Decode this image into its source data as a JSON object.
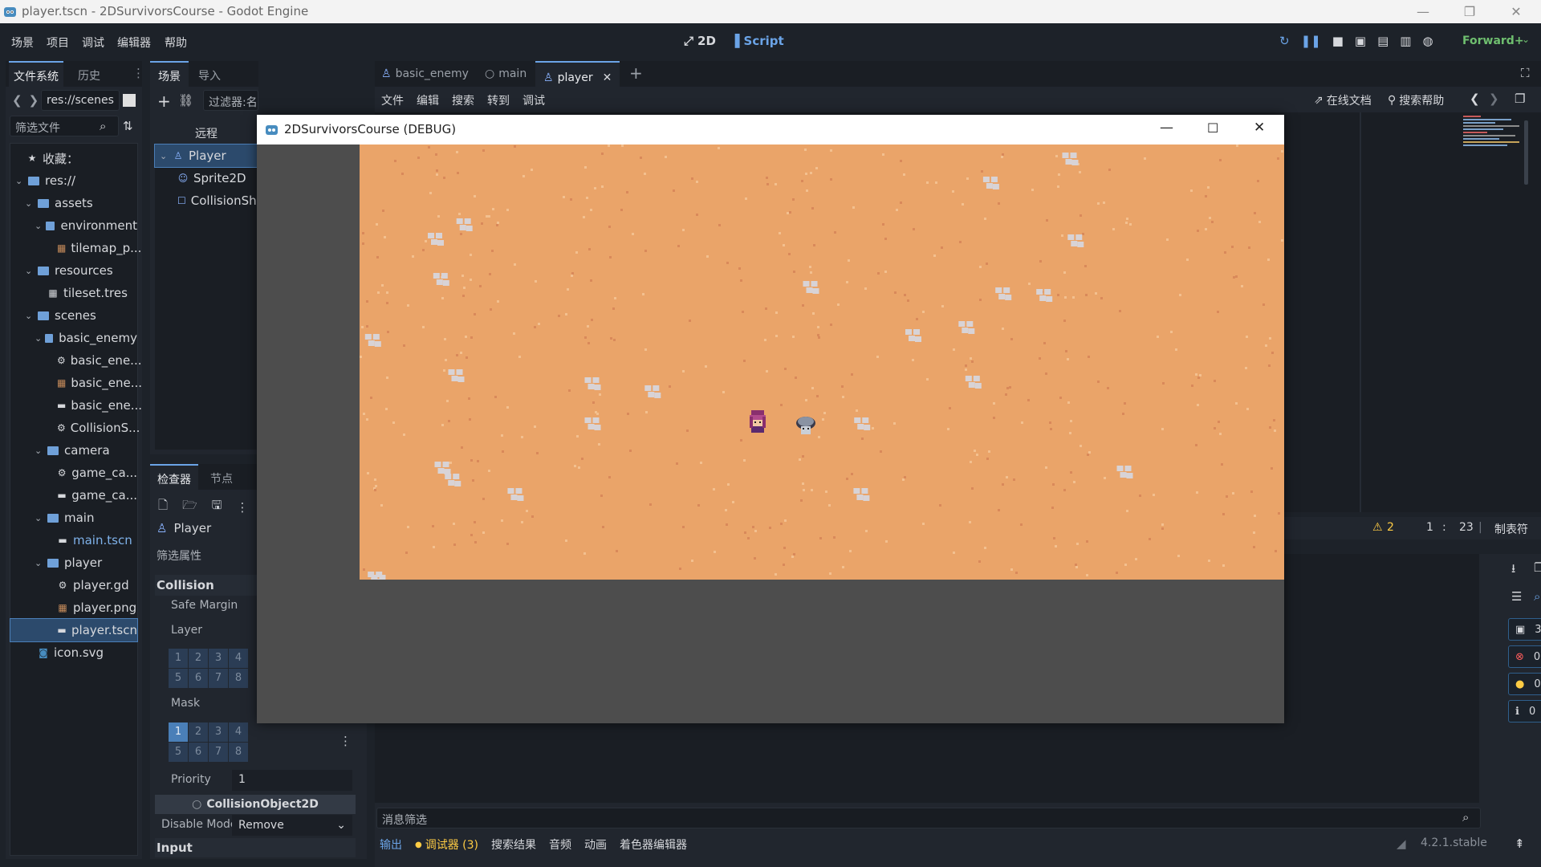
{
  "window": {
    "title": "player.tscn - 2DSurvivorsCourse - Godot Engine",
    "controls": [
      "—",
      "❐",
      "✕"
    ]
  },
  "menubar": {
    "items": [
      "场景",
      "项目",
      "调试",
      "编辑器",
      "帮助"
    ],
    "workspace_2d": "2D",
    "workspace_script": "Script",
    "renderer": "Forward+"
  },
  "filesystem": {
    "tab_files": "文件系统",
    "tab_history": "历史",
    "path": "res://scenes",
    "filter_placeholder": "筛选文件",
    "tree": [
      {
        "label": "收藏：",
        "depth": 0,
        "kind": "star"
      },
      {
        "label": "res://",
        "depth": 0,
        "kind": "folder"
      },
      {
        "label": "assets",
        "depth": 1,
        "kind": "folder"
      },
      {
        "label": "environment",
        "depth": 2,
        "kind": "folder"
      },
      {
        "label": "tilemap_p...",
        "depth": 3,
        "kind": "image"
      },
      {
        "label": "resources",
        "depth": 1,
        "kind": "folder"
      },
      {
        "label": "tileset.tres",
        "depth": 2,
        "kind": "tileset"
      },
      {
        "label": "scenes",
        "depth": 1,
        "kind": "folder"
      },
      {
        "label": "basic_enemy",
        "depth": 2,
        "kind": "folder"
      },
      {
        "label": "basic_ene...",
        "depth": 3,
        "kind": "gear"
      },
      {
        "label": "basic_ene...",
        "depth": 3,
        "kind": "image"
      },
      {
        "label": "basic_ene...",
        "depth": 3,
        "kind": "scene"
      },
      {
        "label": "CollisionS...",
        "depth": 3,
        "kind": "gear"
      },
      {
        "label": "camera",
        "depth": 2,
        "kind": "folder"
      },
      {
        "label": "game_ca...",
        "depth": 3,
        "kind": "gear"
      },
      {
        "label": "game_ca...",
        "depth": 3,
        "kind": "scene"
      },
      {
        "label": "main",
        "depth": 2,
        "kind": "folder"
      },
      {
        "label": "main.tscn",
        "depth": 3,
        "kind": "scene"
      },
      {
        "label": "player",
        "depth": 2,
        "kind": "folder"
      },
      {
        "label": "player.gd",
        "depth": 3,
        "kind": "gear"
      },
      {
        "label": "player.png",
        "depth": 3,
        "kind": "image"
      },
      {
        "label": "player.tscn",
        "depth": 3,
        "kind": "scene"
      },
      {
        "label": "icon.svg",
        "depth": 1,
        "kind": "svg"
      }
    ]
  },
  "scene_dock": {
    "tab_scene": "场景",
    "tab_import": "导入",
    "filter_placeholder": "过滤器:名称、t:",
    "remote": "远程",
    "nodes": [
      "Player",
      "Sprite2D",
      "CollisionSha"
    ]
  },
  "inspector": {
    "tab_inspector": "检查器",
    "tab_node": "节点",
    "object_name": "Player",
    "filter_placeholder": "筛选属性",
    "section_collision": "Collision",
    "safe_margin": "Safe Margin",
    "layer": "Layer",
    "mask": "Mask",
    "bits": [
      "1",
      "2",
      "3",
      "4",
      "5",
      "6",
      "7",
      "8"
    ],
    "priority_label": "Priority",
    "priority_value": "1",
    "collision_object": "CollisionObject2D",
    "disable_mode_label": "Disable Mode",
    "disable_mode_value": "Remove",
    "section_input": "Input"
  },
  "editor_tabs": [
    "basic_enemy",
    "main",
    "player"
  ],
  "script_menu": [
    "文件",
    "编辑",
    "搜索",
    "转到",
    "调试"
  ],
  "script_right": {
    "docs": "在线文档",
    "search_help": "搜索帮助"
  },
  "status": {
    "warnings": "2",
    "line": "1",
    "col": "23",
    "indent": "制表符"
  },
  "game": {
    "title": "2DSurvivorsCourse (DEBUG)"
  },
  "bottom": {
    "filter_placeholder": "消息筛选",
    "tabs": [
      "输出",
      "调试器 (3)",
      "搜索结果",
      "音频",
      "动画",
      "着色器编辑器"
    ],
    "version": "4.2.1.stable",
    "counts": {
      "messages": "3",
      "errors": "0",
      "warnings": "0",
      "info": "0"
    }
  }
}
